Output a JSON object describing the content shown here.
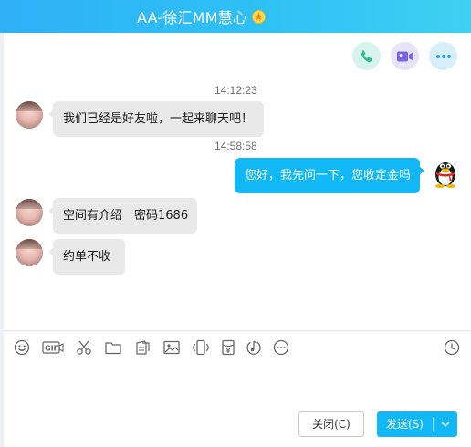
{
  "window": {
    "title": "AA-徐汇MM慧心",
    "title_badge_icon": "vip-star-icon",
    "title_gradient": [
      "#2fb0f7",
      "#3fd0f2"
    ]
  },
  "call_buttons": [
    {
      "name": "voice-call",
      "icon": "phone-icon",
      "color": "#2fbf8f"
    },
    {
      "name": "video-call",
      "icon": "video-camera-icon",
      "color": "#7b63e8"
    },
    {
      "name": "more",
      "icon": "more-dots-icon",
      "color": "#23a5e6"
    }
  ],
  "messages": [
    {
      "type": "timestamp",
      "text": "14:12:23"
    },
    {
      "type": "incoming",
      "text": "我们已经是好友啦，一起来聊天吧！"
    },
    {
      "type": "timestamp",
      "text": "14:58:58"
    },
    {
      "type": "outgoing",
      "text": "您好，我先问一下，您收定金吗"
    },
    {
      "type": "incoming",
      "text": "空间有介绍　密码1686"
    },
    {
      "type": "incoming",
      "text": "约单不收"
    }
  ],
  "toolbar": {
    "items": [
      "emoji-icon",
      "gif-icon",
      "scissors-icon",
      "folder-icon",
      "doc-sheet-icon",
      "image-icon",
      "shake-icon",
      "red-packet-icon",
      "music-icon",
      "more-icon"
    ],
    "history_icon": "clock-history-icon"
  },
  "input": {
    "value": "",
    "placeholder": ""
  },
  "actions": {
    "close_label": "关闭(C)",
    "send_label": "发送(S)",
    "send_color": "#12b7f5"
  }
}
